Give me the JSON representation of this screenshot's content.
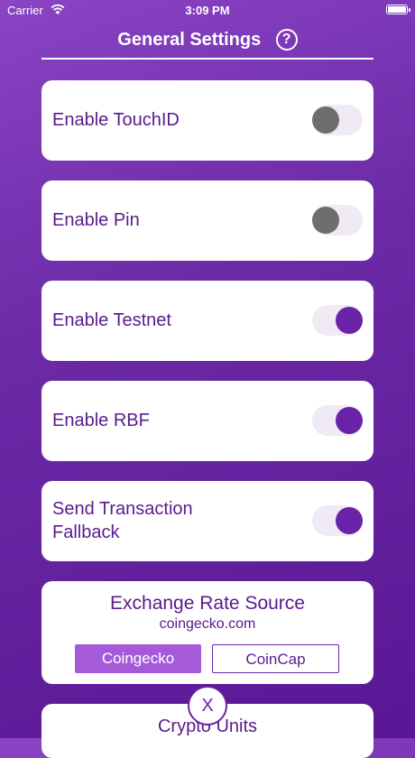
{
  "status_bar": {
    "carrier": "Carrier",
    "time": "3:09 PM"
  },
  "header": {
    "title": "General Settings",
    "help_glyph": "?"
  },
  "settings": [
    {
      "label": "Enable TouchID",
      "enabled": false
    },
    {
      "label": "Enable Pin",
      "enabled": false
    },
    {
      "label": "Enable Testnet",
      "enabled": true
    },
    {
      "label": "Enable RBF",
      "enabled": true
    },
    {
      "label_line1": "Send Transaction",
      "label_line2": "Fallback",
      "enabled": true
    }
  ],
  "exchange": {
    "title": "Exchange Rate Source",
    "subtitle": "coingecko.com",
    "options": [
      "Coingecko",
      "CoinCap"
    ],
    "selected": "Coingecko"
  },
  "units": {
    "title": "Crypto Units"
  },
  "close_button": {
    "label": "X"
  },
  "colors": {
    "accent": "#6a23a8",
    "text": "#5a1a8c",
    "segment_active": "#a55bd9"
  }
}
